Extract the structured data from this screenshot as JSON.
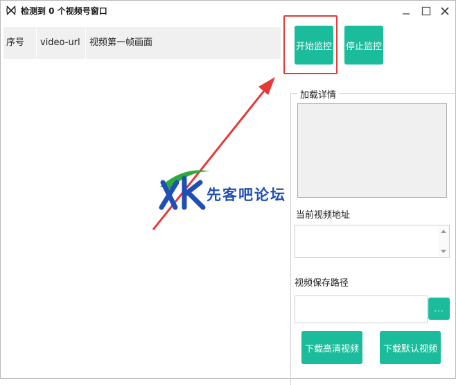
{
  "window": {
    "title": "检测到 0 个视频号窗口",
    "icon": "app-logo-icon",
    "controls": [
      "minimize-icon",
      "maximize-icon",
      "close-icon"
    ]
  },
  "table": {
    "columns": [
      "序号",
      "video-url",
      "视频第一帧画面"
    ],
    "rows": []
  },
  "buttons": {
    "start": "开始监控",
    "stop": "停止监控",
    "browse": "...",
    "download_hd": "下载高清视频",
    "download_default": "下载默认视频"
  },
  "panel": {
    "group_title": "加载详情",
    "current_url_label": "当前视频地址",
    "current_url_value": "",
    "save_path_label": "视频保存路径",
    "save_path_value": ""
  },
  "watermark": {
    "text": "先客吧论坛"
  },
  "colors": {
    "accent": "#1abc9c",
    "highlight": "#e53935",
    "watermark_blue": "#1f4fb5",
    "watermark_green": "#2eaa3a"
  }
}
